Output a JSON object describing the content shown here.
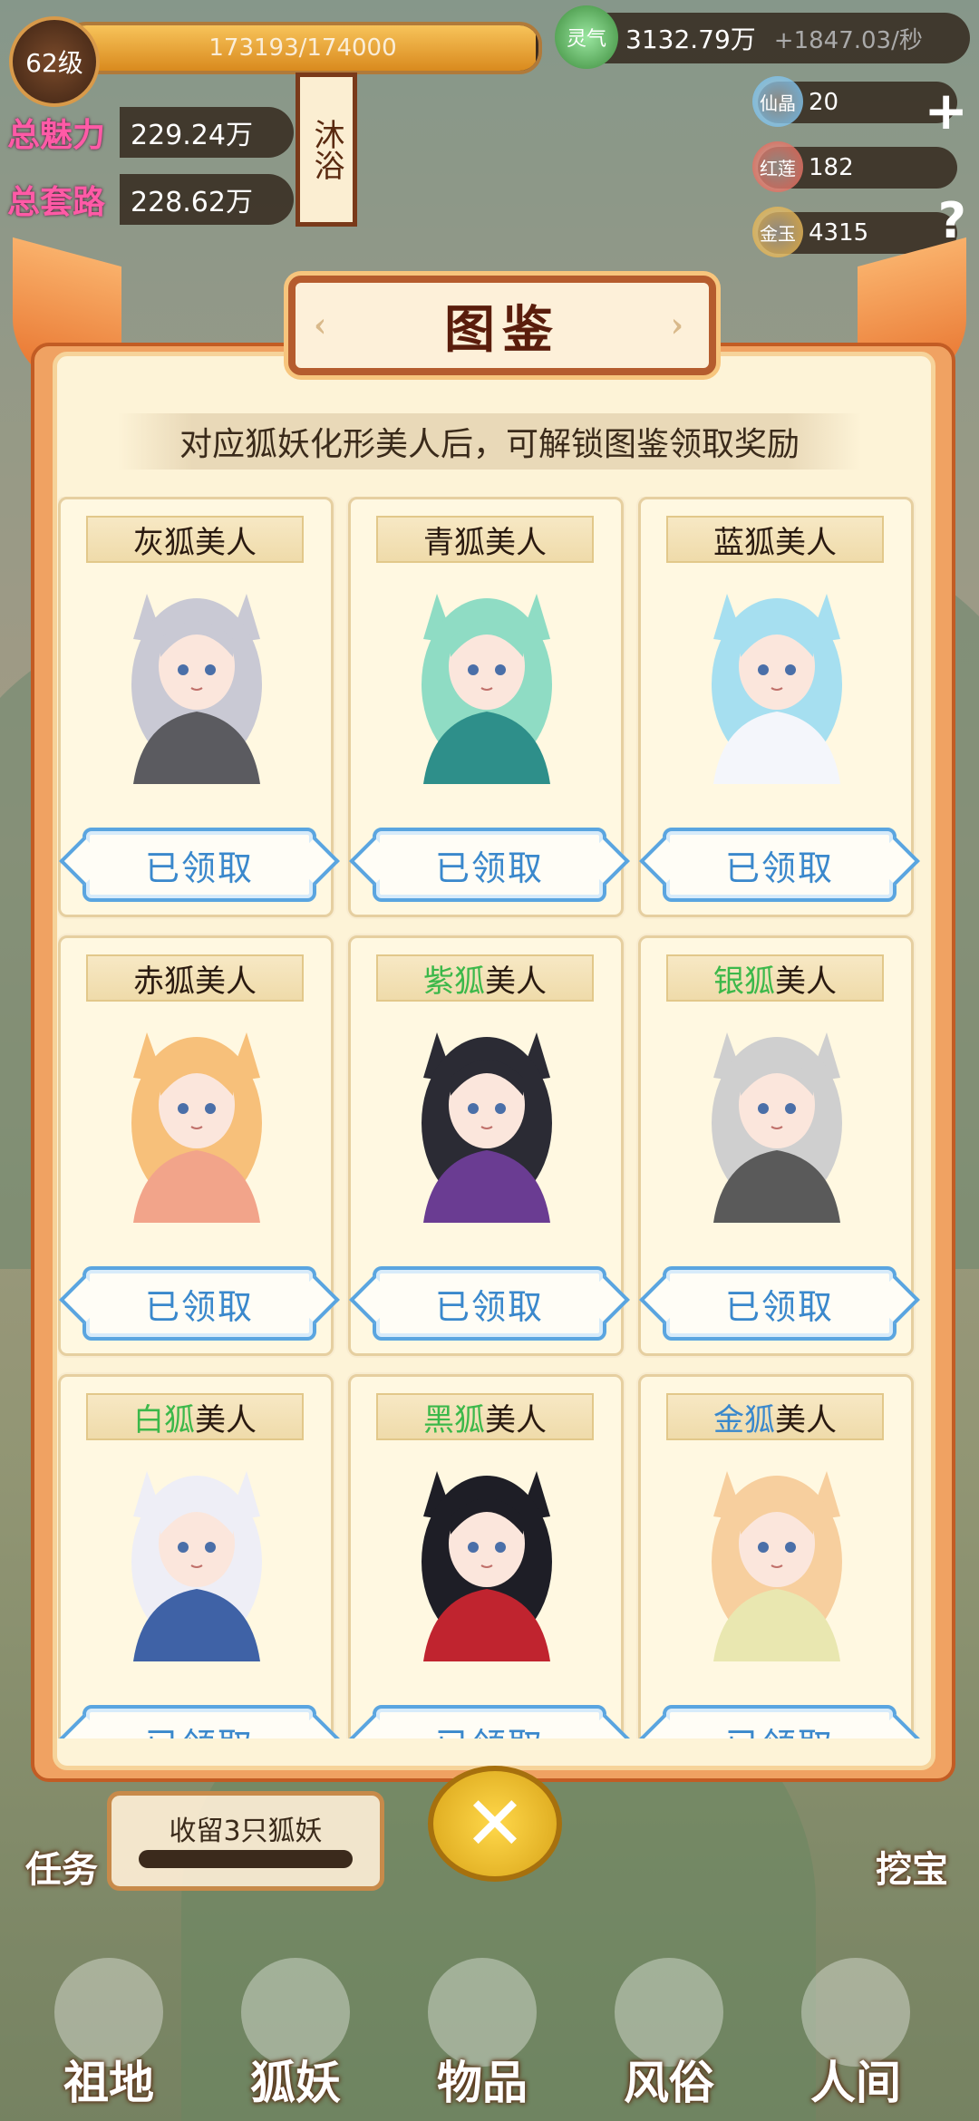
{
  "hud": {
    "level": "62级",
    "exp_text": "173193/174000",
    "exp_progress": 0.995,
    "charm_label": "总魅力",
    "charm_value": "229.24万",
    "tricks_label": "总套路",
    "tricks_value": "228.62万",
    "bath_label": "沐浴",
    "qi_label": "灵气",
    "qi_value": "3132.79万",
    "qi_rate": "+1847.03/秒",
    "resources": [
      {
        "label": "仙晶",
        "value": "20",
        "color": "#6bb8e8"
      },
      {
        "label": "红莲",
        "value": "182",
        "color": "#e05a4a"
      },
      {
        "label": "金玉",
        "value": "4315",
        "color": "#e0a93a"
      }
    ]
  },
  "panel": {
    "title": "图鉴",
    "subtitle": "对应狐妖化形美人后，可解锁图鉴领取奖励",
    "claimed_label": "已领取",
    "cards": [
      {
        "prefix": "灰狐",
        "suffix": "美人",
        "prefix_color": "default",
        "hair": "#c9c9d4",
        "outfit": "#5b5b60",
        "status": "已领取"
      },
      {
        "prefix": "青狐",
        "suffix": "美人",
        "prefix_color": "default",
        "hair": "#8fdcc4",
        "outfit": "#2e8f8a",
        "status": "已领取"
      },
      {
        "prefix": "蓝狐",
        "suffix": "美人",
        "prefix_color": "default",
        "hair": "#a6dff0",
        "outfit": "#f4f6fb",
        "status": "已领取"
      },
      {
        "prefix": "赤狐",
        "suffix": "美人",
        "prefix_color": "default",
        "hair": "#f7c07a",
        "outfit": "#f2a48a",
        "status": "已领取"
      },
      {
        "prefix": "紫狐",
        "suffix": "美人",
        "prefix_color": "green",
        "hair": "#2b2b34",
        "outfit": "#6a3c92",
        "status": "已领取"
      },
      {
        "prefix": "银狐",
        "suffix": "美人",
        "prefix_color": "green",
        "hair": "#cfcfcf",
        "outfit": "#5a5a5a",
        "status": "已领取"
      },
      {
        "prefix": "白狐",
        "suffix": "美人",
        "prefix_color": "green",
        "hair": "#eeeef6",
        "outfit": "#3f62a6",
        "status": "已领取"
      },
      {
        "prefix": "黑狐",
        "suffix": "美人",
        "prefix_color": "green",
        "hair": "#1e1e26",
        "outfit": "#c0242f",
        "status": "已领取"
      },
      {
        "prefix": "金狐",
        "suffix": "美人",
        "prefix_color": "blue",
        "hair": "#f7cf9e",
        "outfit": "#e9e7b0",
        "status": "已领取"
      }
    ]
  },
  "bottom": {
    "task_label": "任务",
    "task_text": "收留3只狐妖",
    "dig_label": "挖宝",
    "nav": [
      "祖地",
      "狐妖",
      "物品",
      "风俗",
      "人间"
    ]
  }
}
